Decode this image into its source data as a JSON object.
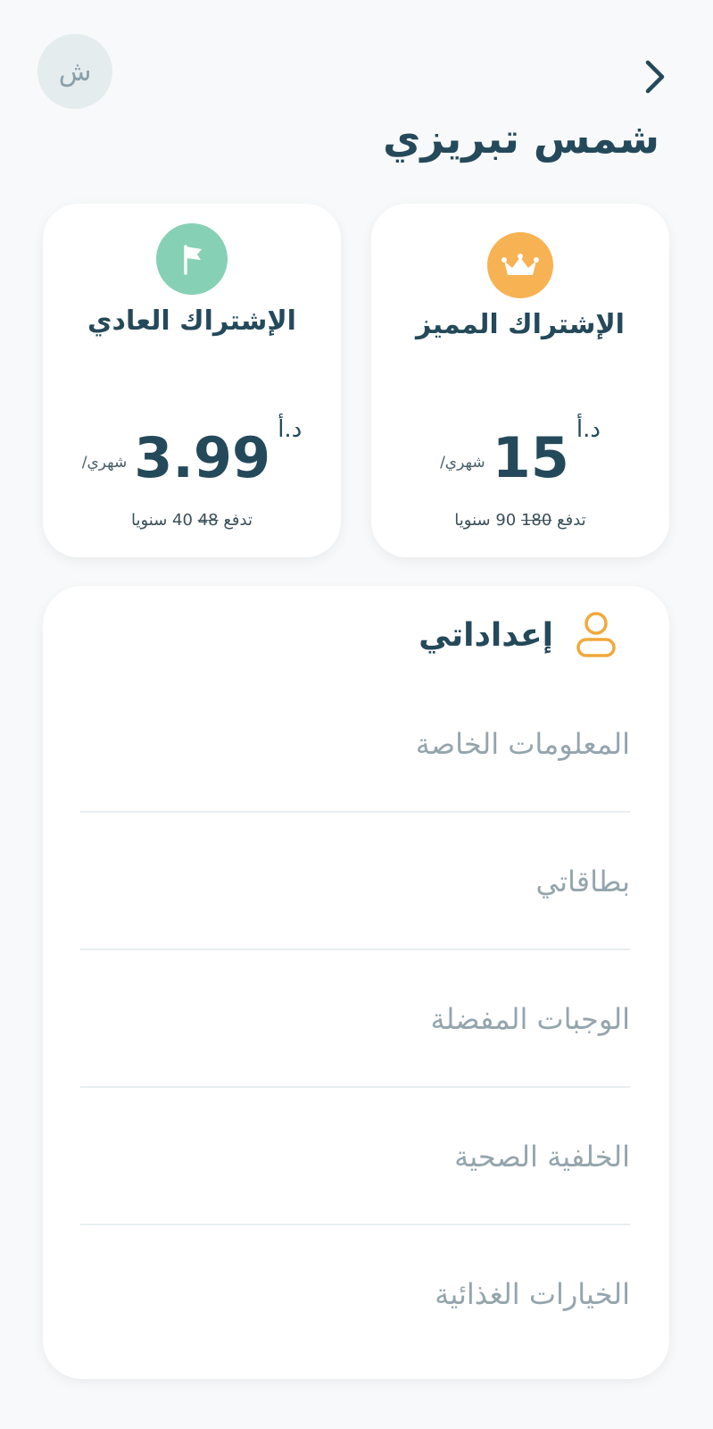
{
  "header": {
    "avatar_initial": "ش",
    "user_name": "شمس تبريزي",
    "back_icon": "chevron-right-icon"
  },
  "plans": {
    "premium": {
      "icon": "crown-icon",
      "icon_color": "#f7b253",
      "title": "الإشتراك المميز",
      "price": "15",
      "currency": "د.أ",
      "period": "/شهري",
      "yearly_prefix": "تدفع",
      "yearly_old": "180",
      "yearly_new": "90 سنويا"
    },
    "basic": {
      "icon": "flag-icon",
      "icon_color": "#86d0b6",
      "title": "الإشتراك العادي",
      "price": "3.99",
      "currency": "د.أ",
      "period": "/شهري",
      "yearly_prefix": "تدفع",
      "yearly_old": "48",
      "yearly_new": "40 سنويا"
    }
  },
  "settings": {
    "title": "إعداداتي",
    "icon": "user-icon",
    "items": [
      {
        "label": "المعلومات الخاصة"
      },
      {
        "label": "بطاقاتي"
      },
      {
        "label": "الوجبات المفضلة"
      },
      {
        "label": "الخلفية الصحية"
      },
      {
        "label": "الخيارات الغذائية"
      }
    ]
  },
  "colors": {
    "primary": "#24495a",
    "accent_orange": "#f7b253",
    "accent_green": "#86d0b6",
    "muted_text": "#95a5ad",
    "background": "#f8f9fa"
  }
}
